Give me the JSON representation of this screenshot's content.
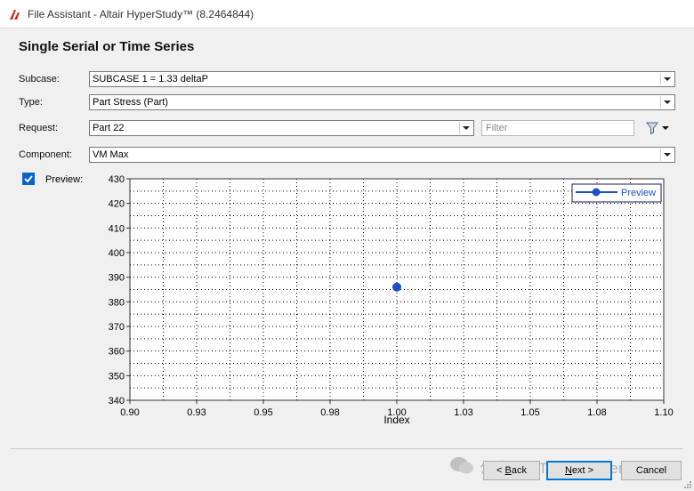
{
  "window": {
    "title": "File Assistant - Altair HyperStudy™ (8.2464844)",
    "icon": "altair-logo-icon"
  },
  "heading": "Single Serial or Time Series",
  "form": {
    "subcase": {
      "label": "Subcase:",
      "value": "SUBCASE 1 = 1.33 deltaP"
    },
    "type": {
      "label": "Type:",
      "value": "Part Stress (Part)"
    },
    "request": {
      "label": "Request:",
      "value": "Part 22",
      "filter_placeholder": "Filter",
      "filter_icon": "funnel-filter-icon"
    },
    "component": {
      "label": "Component:",
      "value": "VM Max"
    },
    "preview": {
      "label": "Preview:",
      "checked": true
    }
  },
  "chart_data": {
    "type": "scatter",
    "xlabel": "Index",
    "ylabel": "",
    "xlim": [
      0.9,
      1.1
    ],
    "ylim": [
      340,
      430
    ],
    "xticks": [
      "0.90",
      "0.93",
      "0.95",
      "0.98",
      "1.00",
      "1.03",
      "1.05",
      "1.08",
      "1.10"
    ],
    "yticks": [
      "430",
      "420",
      "410",
      "400",
      "390",
      "380",
      "370",
      "360",
      "350",
      "340"
    ],
    "series": [
      {
        "name": "Preview",
        "x": [
          1.0
        ],
        "y": [
          386
        ],
        "color": "#1f4fc8"
      }
    ],
    "grid": true,
    "legend": "top-right"
  },
  "buttons": {
    "back": {
      "prefix": "< ",
      "mnemonic": "B",
      "rest": "ack"
    },
    "next": {
      "mnemonic": "N",
      "rest": "ext >"
    },
    "cancel": "Cancel"
  },
  "watermark": "公众号 · TodayCAEer"
}
